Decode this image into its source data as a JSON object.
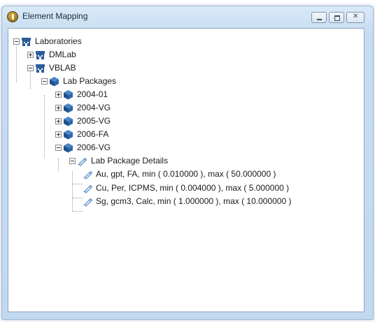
{
  "window": {
    "title": "Element Mapping"
  },
  "tree": {
    "root": "Laboratories",
    "labs": [
      "DMLab",
      "VBLAB"
    ],
    "packages_group": "Lab Packages",
    "packages": [
      "2004-01",
      "2004-VG",
      "2005-VG",
      "2006-FA",
      "2006-VG"
    ],
    "details_group": "Lab Package Details",
    "details": [
      "Au, gpt, FA,  min ( 0.010000 ),  max ( 50.000000 )",
      "Cu, Per, ICPMS,  min ( 0.004000 ),  max ( 5.000000 )",
      "Sg, gcm3, Calc,  min ( 1.000000 ),  max ( 10.000000 )"
    ]
  },
  "icons": {
    "app": "app-icon",
    "lab": "building-icon",
    "package": "cube-icon",
    "detail": "pen-icon"
  },
  "colors": {
    "accent": "#2d5d9a",
    "frame": "#c7dcf1"
  }
}
